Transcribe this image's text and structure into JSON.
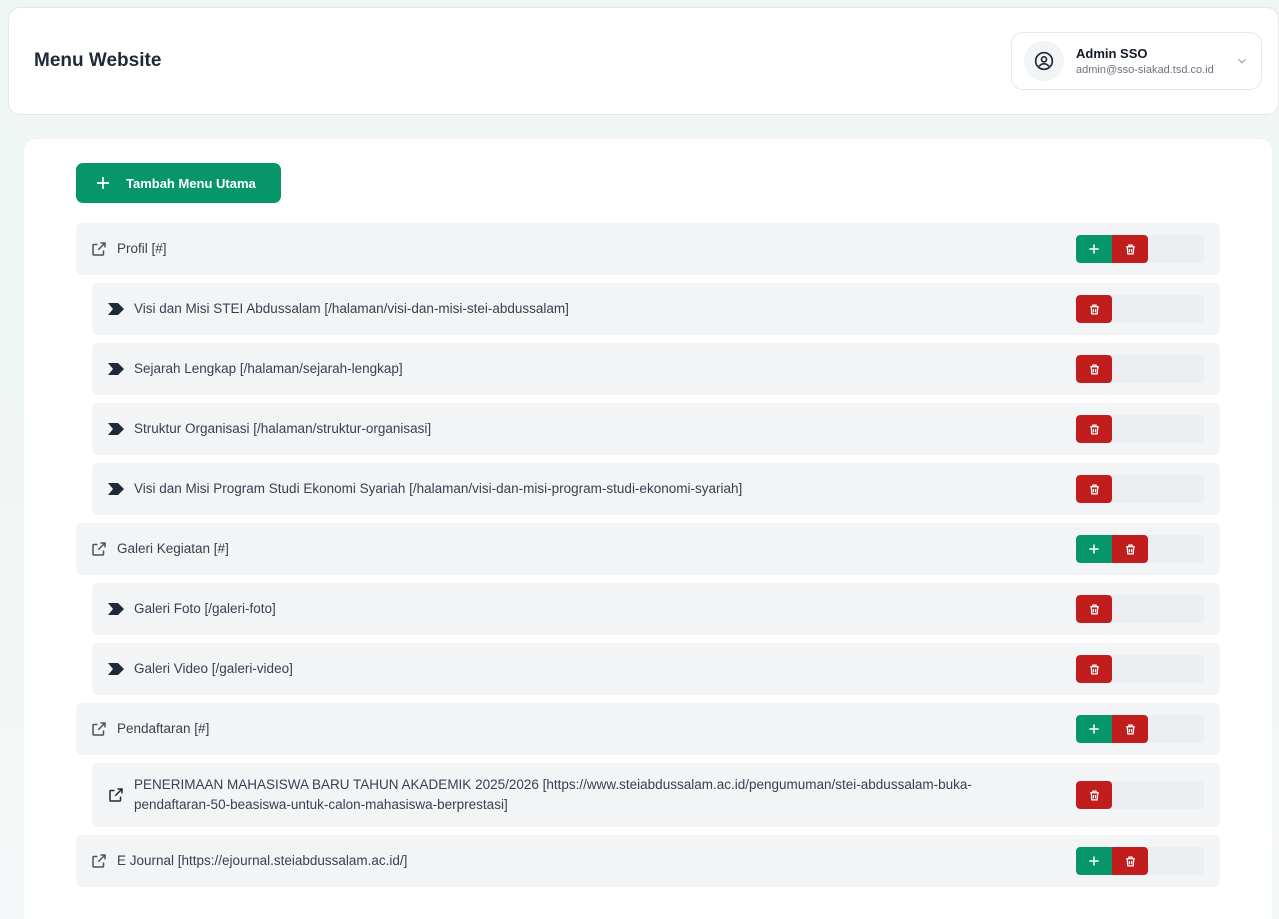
{
  "header": {
    "title": "Menu Website",
    "user": {
      "name": "Admin SSO",
      "email": "admin@sso-siakad.tsd.co.id"
    }
  },
  "toolbar": {
    "add_main_label": "Tambah Menu Utama"
  },
  "colors": {
    "primary": "#079669",
    "danger": "#c21d1d",
    "row_bg": "#f3f4f6"
  },
  "menu": {
    "profil": {
      "label": "Profil [#]",
      "children": [
        "Visi dan Misi STEI Abdussalam [/halaman/visi-dan-misi-stei-abdussalam]",
        "Sejarah Lengkap [/halaman/sejarah-lengkap]",
        "Struktur Organisasi [/halaman/struktur-organisasi]",
        "Visi dan Misi Program Studi Ekonomi Syariah [/halaman/visi-dan-misi-program-studi-ekonomi-syariah]"
      ]
    },
    "galeri": {
      "label": "Galeri Kegiatan [#]",
      "children": [
        "Galeri Foto [/galeri-foto]",
        "Galeri Video [/galeri-video]"
      ]
    },
    "pendaftaran": {
      "label": "Pendaftaran [#]",
      "children": [
        "PENERIMAAN MAHASISWA BARU TAHUN AKADEMIK 2025/2026 [https://www.steiabdussalam.ac.id/pengumuman/stei-abdussalam-buka-pendaftaran-50-beasiswa-untuk-calon-mahasiswa-berprestasi]"
      ]
    },
    "ejournal": {
      "label": "E Journal [https://ejournal.steiabdussalam.ac.id/]"
    }
  }
}
